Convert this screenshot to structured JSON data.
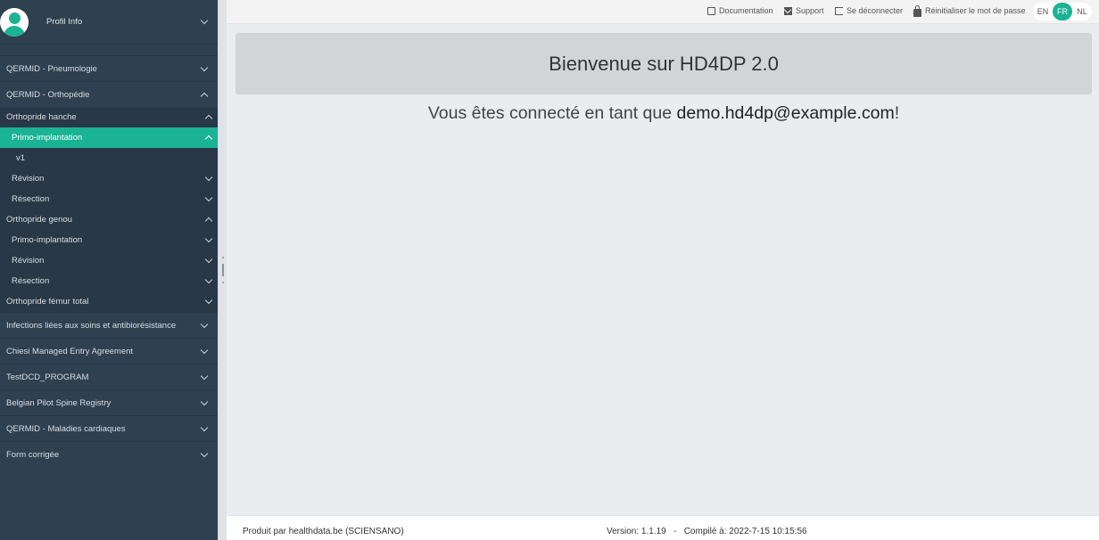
{
  "sidebar": {
    "profile_label": "Profil Info",
    "items": [
      {
        "label": "QERMID - Pneumologie"
      },
      {
        "label": "QERMID - Orthopédie"
      },
      {
        "label": "Orthopride hanche"
      },
      {
        "label": "Primo-implantation"
      },
      {
        "label": "v1"
      },
      {
        "label": "Révision"
      },
      {
        "label": "Résection"
      },
      {
        "label": "Orthopride genou"
      },
      {
        "label": "Primo-implantation"
      },
      {
        "label": "Révision"
      },
      {
        "label": "Résection"
      },
      {
        "label": "Orthopride fémur total"
      },
      {
        "label": "Infections liées aux soins et antibiorésistance"
      },
      {
        "label": "Chiesi Managed Entry Agreement"
      },
      {
        "label": "TestDCD_PROGRAM"
      },
      {
        "label": "Belgian Pilot Spine Registry"
      },
      {
        "label": "QERMID - Maladies cardiaques"
      },
      {
        "label": "Form corrigée"
      }
    ]
  },
  "topbar": {
    "documentation": "Documentation",
    "support": "Support",
    "logout": "Se déconnecter",
    "reset_password": "Réinitialiser le mot de passe",
    "languages": [
      "EN",
      "FR",
      "NL"
    ],
    "active_language": "FR"
  },
  "main": {
    "welcome_title": "Bienvenue sur HD4DP 2.0",
    "connected_prefix": "Vous êtes connecté en tant que ",
    "email": "demo.hd4dp@example.com",
    "connected_suffix": "!"
  },
  "footer": {
    "produced_by": "Produit par healthdata.be (SCIENSANO)",
    "version": "Version: 1.1.19   -   Compilé à: 2022-7-15 10:15:56"
  },
  "colors": {
    "sidebar_bg": "#2f4050",
    "accent": "#1ab394",
    "page_bg": "#e9edf0"
  }
}
